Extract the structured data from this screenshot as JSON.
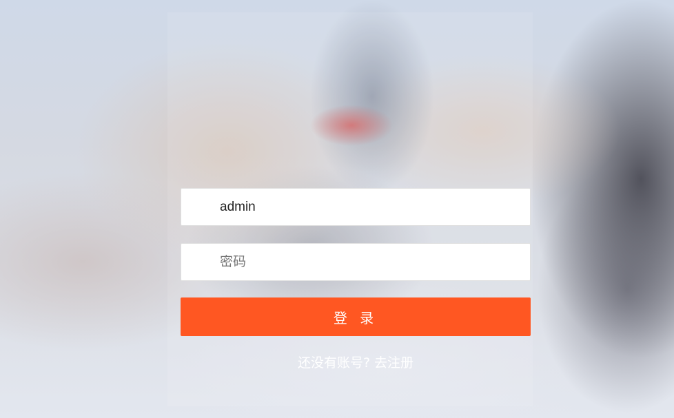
{
  "login_form": {
    "username_value": "admin",
    "password_placeholder": "密码",
    "submit_label": "登 录",
    "register_link_text": "还没有账号? 去注册"
  },
  "colors": {
    "accent": "#ff5722",
    "input_background": "#ffffff",
    "link_text": "#ffffff"
  }
}
